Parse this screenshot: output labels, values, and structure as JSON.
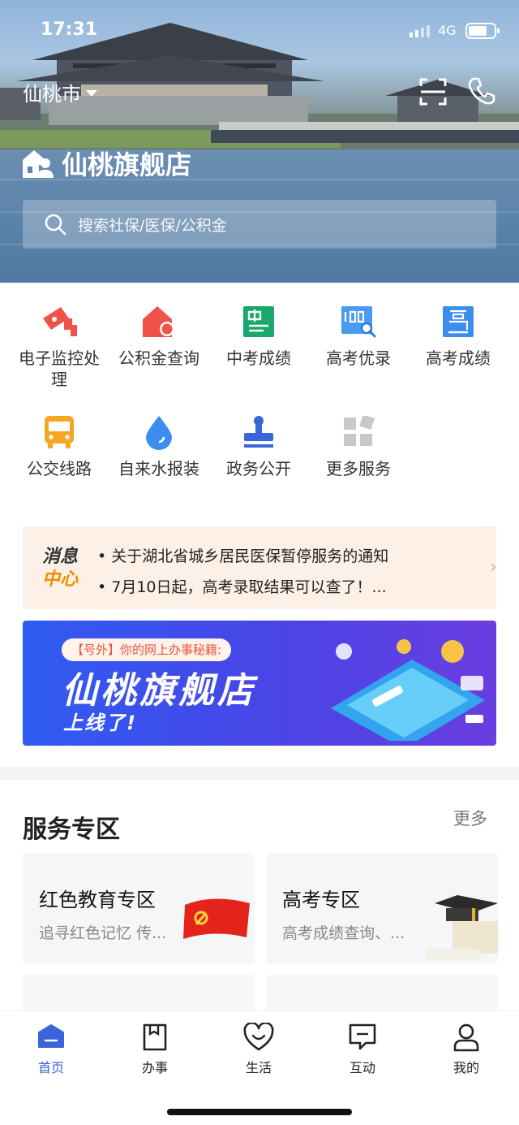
{
  "status_bar": {
    "time": "17:31",
    "network": "4G"
  },
  "header": {
    "city": "仙桃市",
    "brand": "仙桃旗舰店",
    "search_placeholder": "搜索社保/医保/公积金"
  },
  "services": [
    {
      "label": "电子监控处理",
      "icon": "camera-icon",
      "color": "#f0524a"
    },
    {
      "label": "公积金查询",
      "icon": "house-icon",
      "color": "#f0524a"
    },
    {
      "label": "中考成绩",
      "icon": "zhong-exam-icon",
      "color": "#17a86a"
    },
    {
      "label": "高考优录",
      "icon": "score-search-icon",
      "color": "#3b8df0"
    },
    {
      "label": "高考成绩",
      "icon": "gao-exam-icon",
      "color": "#3b8df0"
    },
    {
      "label": "公交线路",
      "icon": "bus-icon",
      "color": "#f5a623"
    },
    {
      "label": "自来水报装",
      "icon": "water-drop-icon",
      "color": "#3b8df0"
    },
    {
      "label": "政务公开",
      "icon": "stamp-icon",
      "color": "#3b66d8"
    },
    {
      "label": "更多服务",
      "icon": "grid-more-icon",
      "color": "#c8c8c8"
    }
  ],
  "notice": {
    "logo_top": "消息",
    "logo_bottom": "中心",
    "items": [
      "• 关于湖北省城乡居民医保暂停服务的通知",
      "• 7月10日起，高考录取结果可以查了！..."
    ]
  },
  "banner": {
    "tag": "【号外】你的网上办事秘籍:",
    "title": "仙桃旗舰店",
    "subtitle": "上线了!"
  },
  "zone": {
    "title": "服务专区",
    "more": "更多",
    "cards": [
      {
        "title": "红色教育专区",
        "subtitle": "追寻红色记忆 传..."
      },
      {
        "title": "高考专区",
        "subtitle": "高考成绩查询、..."
      }
    ]
  },
  "tabs": [
    {
      "label": "首页",
      "icon": "home-icon",
      "active": true
    },
    {
      "label": "办事",
      "icon": "bookmark-icon",
      "active": false
    },
    {
      "label": "生活",
      "icon": "heart-smile-icon",
      "active": false
    },
    {
      "label": "互动",
      "icon": "chat-icon",
      "active": false
    },
    {
      "label": "我的",
      "icon": "person-icon",
      "active": false
    }
  ],
  "colors": {
    "accent": "#3a64d8",
    "notice_bg": "#fdf1e7"
  }
}
